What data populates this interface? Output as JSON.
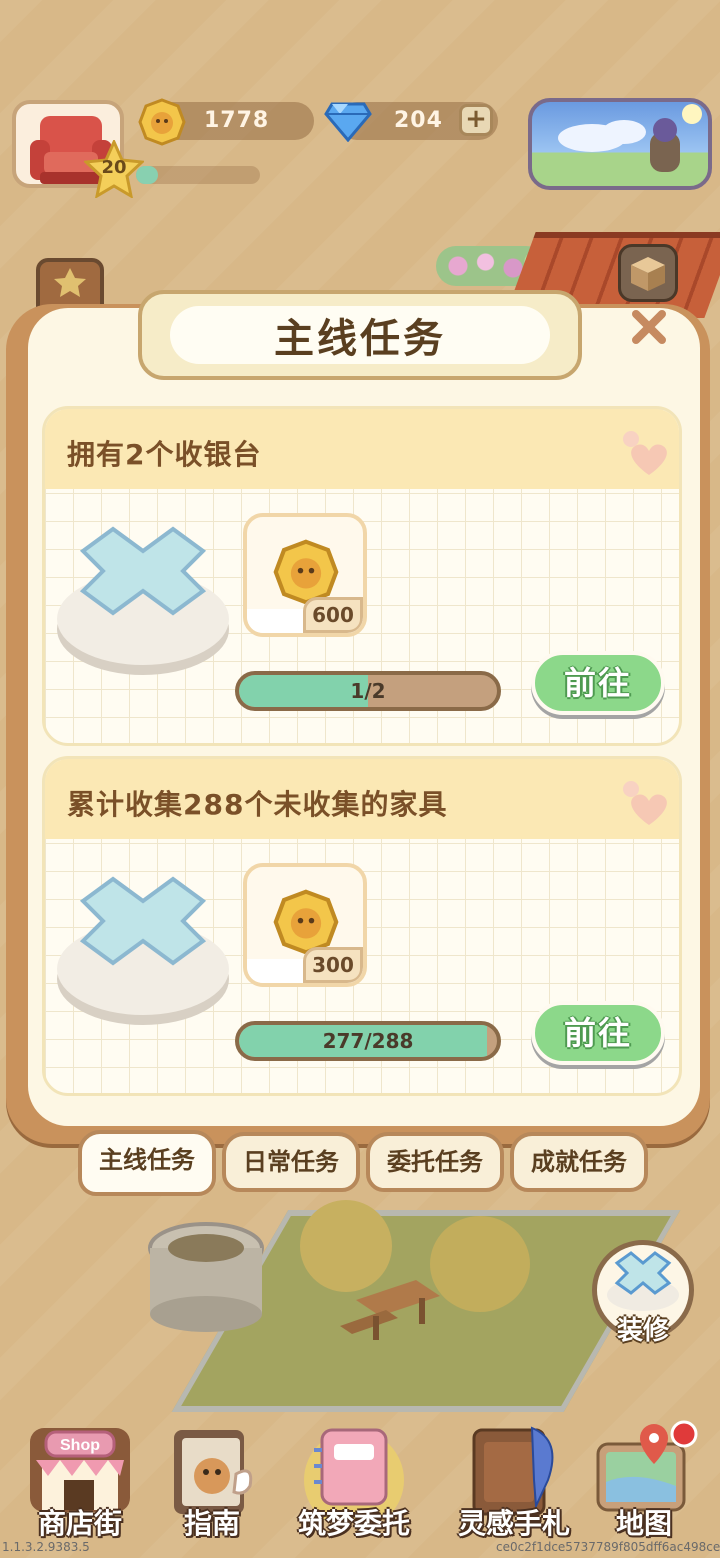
{
  "hud": {
    "level": "20",
    "xp_progress": 0.18,
    "coins": "1778",
    "gems": "204",
    "plus_label": "+"
  },
  "modal": {
    "title": "主线任务",
    "close_label": "✕"
  },
  "tasks": [
    {
      "title": "拥有2个收银台",
      "reward_qty": "600",
      "progress_text": "1/2",
      "progress_value": 0.5,
      "button_label": "前往"
    },
    {
      "title": "累计收集288个未收集的家具",
      "reward_qty": "300",
      "progress_text": "277/288",
      "progress_value": 0.962,
      "button_label": "前往"
    }
  ],
  "tabs": [
    {
      "label": "主线任务",
      "active": true
    },
    {
      "label": "日常任务",
      "active": false
    },
    {
      "label": "委托任务",
      "active": false
    },
    {
      "label": "成就任务",
      "active": false
    }
  ],
  "decorate_label": "装修",
  "nav": [
    {
      "label": "商店街",
      "sign": "Shop"
    },
    {
      "label": "指南"
    },
    {
      "label": "筑梦委托"
    },
    {
      "label": "灵感手札"
    },
    {
      "label": "地图"
    }
  ],
  "version": "1.1.3.2.9383.5",
  "build_hash": "ce0c2f1dce5737789f805dff6ac498ce",
  "colors": {
    "background": "#d8b888",
    "modal_frame": "#c9925c",
    "go_button": "#8cd88a",
    "progress_fill": "#82d2ac",
    "title_text": "#5a3f20"
  }
}
